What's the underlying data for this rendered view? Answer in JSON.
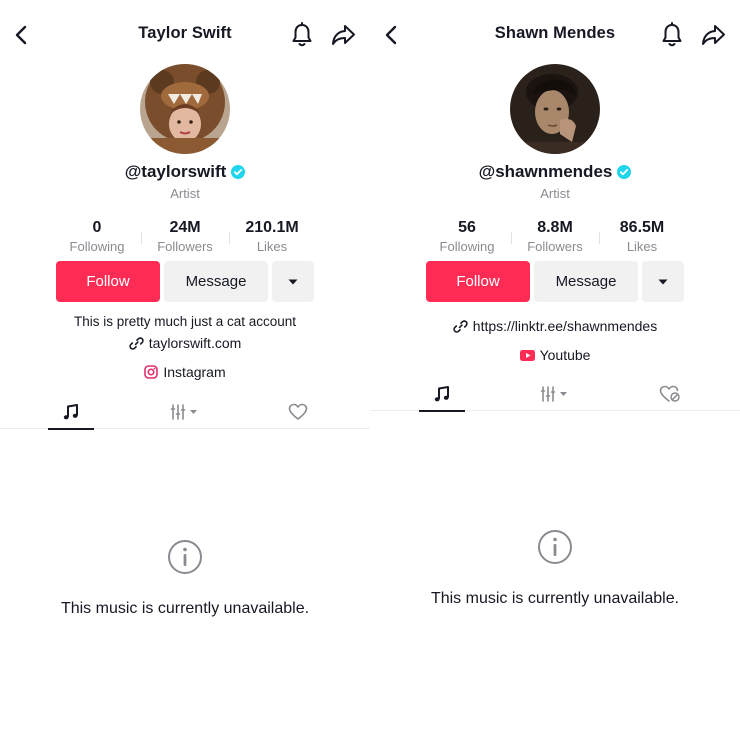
{
  "profiles": [
    {
      "title": "Taylor Swift",
      "handle": "@taylorswift",
      "category": "Artist",
      "stats": [
        {
          "value": "0",
          "label": "Following"
        },
        {
          "value": "24M",
          "label": "Followers"
        },
        {
          "value": "210.1M",
          "label": "Likes"
        }
      ],
      "follow_label": "Follow",
      "message_label": "Message",
      "bio": "This is pretty much just a cat account",
      "website": "taylorswift.com",
      "social_link": "Instagram",
      "empty_message": "This music is currently unavailable."
    },
    {
      "title": "Shawn Mendes",
      "handle": "@shawnmendes",
      "category": "Artist",
      "stats": [
        {
          "value": "56",
          "label": "Following"
        },
        {
          "value": "8.8M",
          "label": "Followers"
        },
        {
          "value": "86.5M",
          "label": "Likes"
        }
      ],
      "follow_label": "Follow",
      "message_label": "Message",
      "website": "https://linktr.ee/shawnmendes",
      "social_link": "Youtube",
      "empty_message": "This music is currently unavailable."
    }
  ],
  "colors": {
    "accent": "#fe2c55",
    "verified": "#20d5ec",
    "muted_text": "#8a8b91",
    "button_gray": "#f1f1f2"
  },
  "icons": {
    "back": "chevron-left-icon",
    "bell": "bell-icon",
    "share": "share-icon",
    "verified": "verified-badge-icon",
    "more": "caret-down-icon",
    "link": "link-icon",
    "instagram": "instagram-icon",
    "youtube": "youtube-icon",
    "music_tab": "music-note-icon",
    "filter_tab": "filter-bars-icon",
    "liked_tab": "heart-icon",
    "liked_hidden_tab": "heart-hidden-icon",
    "info": "info-circle-icon"
  }
}
